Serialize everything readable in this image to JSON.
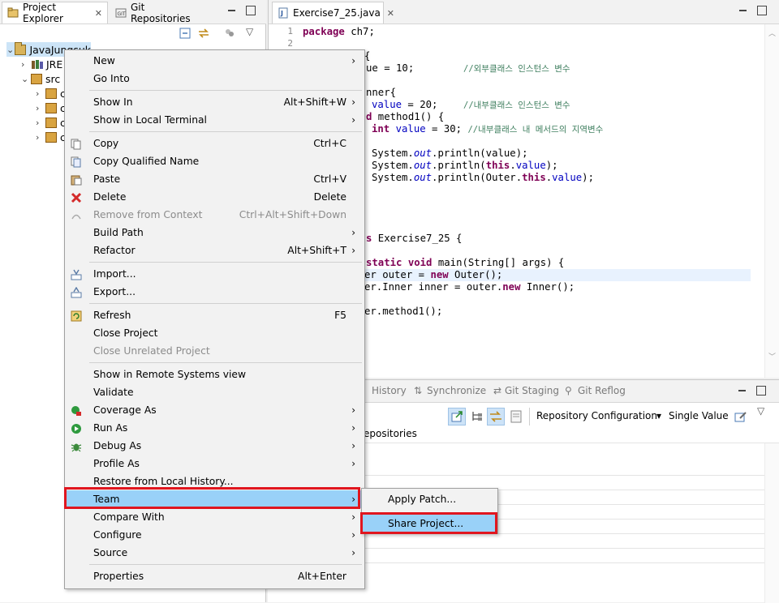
{
  "left_pane": {
    "tabs": [
      {
        "label": "Project Explorer",
        "close": "✕"
      },
      {
        "label": "Git Repositories"
      }
    ],
    "tree": [
      {
        "chevron": "⌄",
        "label": "JavaJungsuk"
      },
      {
        "chevron": "›",
        "label": "JRE"
      },
      {
        "chevron": "⌄",
        "label": "src"
      },
      {
        "chevron": "›",
        "label": "c"
      },
      {
        "chevron": "›",
        "label": "c"
      },
      {
        "chevron": "›",
        "label": "c"
      },
      {
        "chevron": "›",
        "label": "c"
      }
    ]
  },
  "editor": {
    "tab_label": "Exercise7_25.java",
    "tab_close": "✕",
    "line_numbers": [
      "1",
      "2"
    ]
  },
  "code": {
    "l1_kw": "package",
    "l1_rest": " ch7;",
    "l3": "{",
    "l4_a": "ue = 10;",
    "l4_cm": "//외부클래스 인스턴스 변수",
    "l6": "nner{",
    "l7_fld": "value",
    "l7_a": " = 20;",
    "l7_cm": "//내부클래스 인스턴스 변수",
    "l8_kw": "d",
    "l8_rest": " method1() {",
    "l9_kw": "int",
    "l9_fld": "value",
    "l9_a": " = 30; ",
    "l9_cm": "//내부클래스 내 메서드의 지역변수",
    "l11_a": "System.",
    "l11_st": "out",
    "l11_b": ".println(value);",
    "l12_a": "System.",
    "l12_st": "out",
    "l12_b": ".println(",
    "l12_kw": "this",
    "l12_c": ".",
    "l12_fld": "value",
    "l12_d": ");",
    "l13_a": "System.",
    "l13_st": "out",
    "l13_b": ".println(Outer.",
    "l13_kw": "this",
    "l13_c": ".",
    "l13_fld": "value",
    "l13_d": ");",
    "l18_kw": "s",
    "l18_rest": " Exercise7_25 {",
    "l20_kw1": "static",
    "l20_sp": " ",
    "l20_kw2": "void",
    "l20_rest": " main(String[] args) {",
    "l21_a": "er outer = ",
    "l21_kw": "new",
    "l21_b": " Outer();",
    "l22_a": "er.Inner inner = outer.",
    "l22_kw": "new",
    "l22_b": " Inner();",
    "l24": "er.method1();"
  },
  "bottom": {
    "tabs": [
      "History",
      "Synchronize",
      "Git Staging",
      "Git Reflog"
    ],
    "repo_config": "Repository Configuration",
    "single_value": "Single Value",
    "dd_arrow": "▾",
    "header": "epositories"
  },
  "context_menu": {
    "items": [
      {
        "label": "New",
        "arrow": "›"
      },
      {
        "label": "Go Into"
      },
      {
        "label": "Show In",
        "shortcut": "Alt+Shift+W",
        "arrow": "›"
      },
      {
        "label": "Show in Local Terminal",
        "arrow": "›"
      },
      {
        "label": "Copy",
        "shortcut": "Ctrl+C"
      },
      {
        "label": "Copy Qualified Name"
      },
      {
        "label": "Paste",
        "shortcut": "Ctrl+V"
      },
      {
        "label": "Delete",
        "shortcut": "Delete"
      },
      {
        "label": "Remove from Context",
        "shortcut": "Ctrl+Alt+Shift+Down"
      },
      {
        "label": "Build Path",
        "arrow": "›"
      },
      {
        "label": "Refactor",
        "shortcut": "Alt+Shift+T",
        "arrow": "›"
      },
      {
        "label": "Import..."
      },
      {
        "label": "Export..."
      },
      {
        "label": "Refresh",
        "shortcut": "F5"
      },
      {
        "label": "Close Project"
      },
      {
        "label": "Close Unrelated Project"
      },
      {
        "label": "Show in Remote Systems view"
      },
      {
        "label": "Validate"
      },
      {
        "label": "Coverage As",
        "arrow": "›"
      },
      {
        "label": "Run As",
        "arrow": "›"
      },
      {
        "label": "Debug As",
        "arrow": "›"
      },
      {
        "label": "Profile As",
        "arrow": "›"
      },
      {
        "label": "Restore from Local History..."
      },
      {
        "label": "Team",
        "arrow": "›"
      },
      {
        "label": "Compare With",
        "arrow": "›"
      },
      {
        "label": "Configure",
        "arrow": "›"
      },
      {
        "label": "Source",
        "arrow": "›"
      },
      {
        "label": "Properties",
        "shortcut": "Alt+Enter"
      }
    ]
  },
  "team_submenu": {
    "items": [
      {
        "label": "Apply Patch..."
      },
      {
        "label": "Share Project..."
      }
    ]
  },
  "colors": {
    "highlight": "#99d1f8",
    "annotation_red": "#e0161f"
  }
}
